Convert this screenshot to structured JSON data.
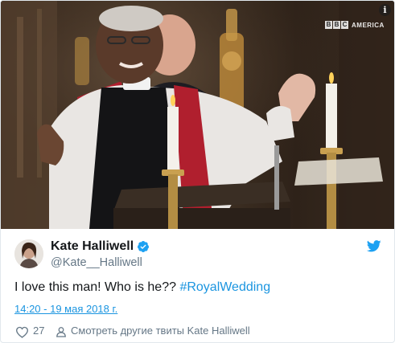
{
  "media": {
    "info_label": "i",
    "watermark": {
      "letters": [
        "B",
        "B",
        "C"
      ],
      "word": "AMERICA"
    }
  },
  "author": {
    "name": "Kate Halliwell",
    "handle": "@Kate__Halliwell",
    "verified": true
  },
  "tweet": {
    "text": "I love this man! Who is he?? ",
    "hashtag": "#RoyalWedding",
    "timestamp": "14:20 - 19 мая 2018 г."
  },
  "actions": {
    "like_count": "27",
    "more_tweets_label": "Смотреть другие твиты Kate Halliwell"
  },
  "colors": {
    "link": "#1b95e0",
    "secondary_text": "#657786",
    "primary_text": "#14171a",
    "border": "#e1e8ed"
  },
  "icons": {
    "info": "info-icon",
    "verified": "verified-badge-icon",
    "brand": "twitter-bird-icon",
    "like": "heart-icon",
    "more": "person-icon"
  }
}
